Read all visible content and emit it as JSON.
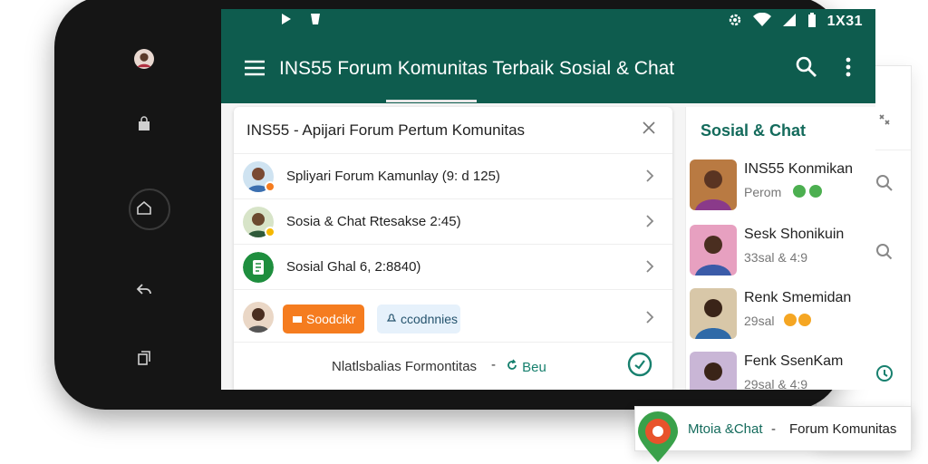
{
  "status_bar": {
    "time": "1X31"
  },
  "app_bar": {
    "title": "INS55 Forum Komunitas Terbaik Sosial & Chat"
  },
  "main_card": {
    "title": "INS55 - Apijari Forum Pertum Komunitas",
    "rows": [
      {
        "label": "Spliyari Forum Kamunlay (9: d 125)"
      },
      {
        "label": "Sosia & Chat Rtesakse 2:45)"
      },
      {
        "label": "Sosial Ghal 6, 2:8840)"
      }
    ],
    "chip_orange": "Soodcikr",
    "chip_blue": "ccodnnies",
    "footer_text": "Nlatlsbalias Formontitas",
    "footer_dash": "-",
    "footer_link": "Beu"
  },
  "right_panel": {
    "heading": "Sosial & Chat",
    "items": [
      {
        "name": "INS55 Konmikan",
        "sub": "Perom"
      },
      {
        "name": "Sesk Shonikuin",
        "sub": "33sal & 4:9"
      },
      {
        "name": "Renk Smemidan",
        "sub": "29sal"
      },
      {
        "name": "Fenk SsenKam",
        "sub": "29sal & 4:9"
      }
    ]
  },
  "floating_card": {
    "label_a": "Mtoia &Chat",
    "dash": "-",
    "label_b": "Forum Komunitas"
  },
  "colors": {
    "brand_green": "#0e5c4e",
    "accent_orange": "#f57c1f",
    "chip_blue_bg": "#e6f1fb"
  },
  "icons": {
    "menu": "hamburger-icon",
    "search": "search-icon",
    "more": "more-vert-icon",
    "close": "close-icon",
    "chevron": "chevron-right-icon"
  }
}
